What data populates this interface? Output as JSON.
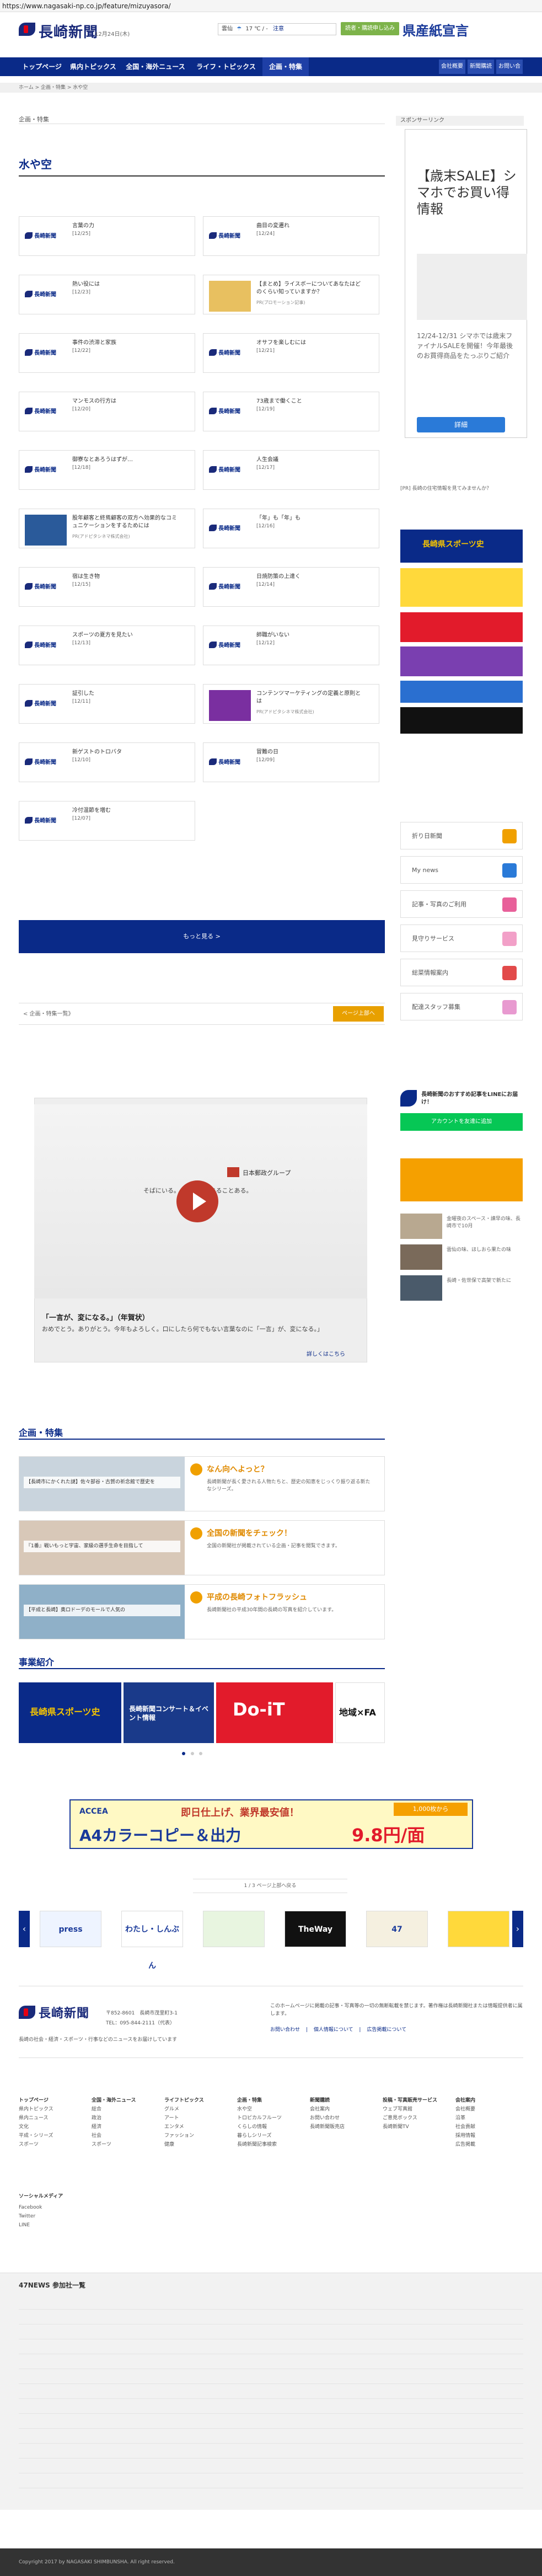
{
  "browser": {
    "url": "https://www.nagasaki-np.co.jp/feature/mizuyasora/"
  },
  "header": {
    "logo": "長崎新聞",
    "date": "12月24日(木)",
    "weather_label": "雲仙",
    "weather_temp": "17 ℃ / -",
    "weather_link": "注意",
    "login_label": "読者・購読申し込み",
    "ken_banner": "県産紙宣言"
  },
  "nav": {
    "items": [
      "トップページ",
      "県内トピックス",
      "全国・海外ニュース",
      "ライフ・トピックス",
      "企画・特集"
    ],
    "sub": [
      "会社概要",
      "新聞購読",
      "お問い合わせ"
    ]
  },
  "breadcrumb": "ホーム > 企画・特集 > 水や空",
  "section_label": "企画・特集",
  "page_title": "水や空",
  "articles": [
    {
      "title": "言葉の力",
      "date": "[12/25]",
      "sub": ""
    },
    {
      "title": "曲目の変遷れ",
      "date": "[12/24]",
      "sub": ""
    },
    {
      "title": "熱い役には",
      "date": "[12/23]",
      "sub": ""
    },
    {
      "title": "【まとめ】ライスボーについてあなたはどのくらい知っていますか？",
      "date": "",
      "sub": "PR(プロモーション記事)"
    },
    {
      "title": "事件の渋滞と家族",
      "date": "[12/22]",
      "sub": ""
    },
    {
      "title": "オサフを楽しむには",
      "date": "[12/21]",
      "sub": ""
    },
    {
      "title": "マンモスの行方は",
      "date": "[12/20]",
      "sub": ""
    },
    {
      "title": "73歳まで働くこと",
      "date": "[12/19]",
      "sub": ""
    },
    {
      "title": "御寮なとあろうはずが…",
      "date": "[12/18]",
      "sub": ""
    },
    {
      "title": "人生会議",
      "date": "[12/17]",
      "sub": ""
    },
    {
      "title": "股年顧客と終焉顧客の双方へ効果的なコミュニケーションをするためには",
      "date": "",
      "sub": "PR(アドピタシネマ株式会社)"
    },
    {
      "title": "「年」も「年」も",
      "date": "[12/16]",
      "sub": ""
    },
    {
      "title": "宿は生き物",
      "date": "[12/15]",
      "sub": ""
    },
    {
      "title": "日焼防策の上達く",
      "date": "[12/14]",
      "sub": ""
    },
    {
      "title": "スポーツの夏方を見たい",
      "date": "[12/13]",
      "sub": ""
    },
    {
      "title": "師職がいない",
      "date": "[12/12]",
      "sub": ""
    },
    {
      "title": "証引した",
      "date": "[12/11]",
      "sub": ""
    },
    {
      "title": "コンテンツマーケティングの定義と原則とは",
      "date": "",
      "sub": "PR(アドピタシネマ株式会社)"
    },
    {
      "title": "新ゲストのトロバタ",
      "date": "[12/10]",
      "sub": ""
    },
    {
      "title": "冒難の日",
      "date": "[12/09]",
      "sub": ""
    },
    {
      "title": "冷付温節を増む",
      "date": "[12/07]",
      "sub": ""
    }
  ],
  "more_label": "もっと見る >",
  "pager": {
    "prev": "< 企画・特集一覧》",
    "next": "ページ上部へ"
  },
  "video_ad": {
    "brand": "日本郵政グループ",
    "tagline": "そばにいる。それが、できることある。",
    "headline": "「一言が、変になる。」（年賀状）",
    "body": "おめでとう。ありがとう。今年もよろしく。口にしたら何でもない言葉なのに「一言」が、変になる。」",
    "link": "詳しくはこちら"
  },
  "features_title": "企画・特集",
  "features": [
    {
      "left": "【長崎市にかくれた謎】佐々部谷・古賀の祈念館で歴史を",
      "right_title": "なん向へよっと？",
      "right_desc": "長崎新聞が長く愛される人物たちと、歴史の知恵をじっくり振り返る新たなシリーズ。"
    },
    {
      "left": "『1番』戦いもっと宇宙、家級の選手生命を目指して",
      "right_title": "全国の新聞をチェック！",
      "right_desc": "全国の新聞社が掲載されている企画・記事を閲覧できます。"
    },
    {
      "left": "【平成と長崎】奥ロドーデのモールで人気の",
      "right_title": "平成の長崎フォトフラッシュ",
      "right_desc": "長崎新聞社の平成30年間の長崎の写真を紹介しています。"
    }
  ],
  "projects_title": "事業紹介",
  "projects": [
    "長崎県スポーツ史",
    "長崎新聞コンサート＆イベント情報",
    "Do-iT",
    "地域×FA"
  ],
  "ad_banner": {
    "brand": "ACCEA",
    "line1": "即日仕上げ、業界最安値！",
    "line2": "A4カラーコピー＆出力",
    "price": "9.8円/面",
    "badge": "1,000枚から"
  },
  "carousel_caption": "1 / 3 ページ上部へ戻る",
  "carousel": [
    "press",
    "わたし・しんぶん",
    "",
    "TheWay",
    "47",
    ""
  ],
  "footer": {
    "address": "〒852-8601　長崎市茂里町3-1",
    "tel": "TEL：095-844-2111（代表）",
    "note": "長崎の社会・経済・スポーツ・行事などのニュースをお届けしています",
    "disclaimer": "このホームページに掲載の記事・写真等の一切の無断転載を禁じます。著作権は長崎新聞社または情報提供者に属します。",
    "links": [
      "お問い合わせ",
      "個人情報について",
      "広告掲載について"
    ],
    "columns": [
      {
        "head": "トップページ",
        "items": [
          "県内トピックス",
          "県内ニュース",
          "文化",
          "平成・シリーズ",
          "スポーツ"
        ]
      },
      {
        "head": "全国・海外ニュース",
        "items": [
          "総合",
          "政治",
          "経済",
          "社会",
          "スポーツ"
        ]
      },
      {
        "head": "ライフトピックス",
        "items": [
          "グルメ",
          "アート",
          "エンタメ",
          "ファッション",
          "健康"
        ]
      },
      {
        "head": "企画・特集",
        "items": [
          "水や空",
          "トロピカルフルーツ",
          "くらしの情報",
          "暮らしシリーズ",
          "長崎新聞記事検索"
        ]
      },
      {
        "head": "新聞購読",
        "items": [
          "会社案内",
          "お問い合わせ",
          "長崎新聞販売店"
        ]
      },
      {
        "head": "投稿・写真販売サービス",
        "items": [
          "ウェブ写真館",
          "ご意見ボックス",
          "長崎新聞TV"
        ]
      },
      {
        "head": "会社案内",
        "items": [
          "会社概要",
          "沿革",
          "社会貢献",
          "採用情報",
          "広告掲載"
        ]
      }
    ],
    "social_head": "ソーシャルメディア",
    "social": [
      "Facebook",
      "Twitter",
      "LINE"
    ]
  },
  "news47": {
    "title": "47NEWS 参加社一覧",
    "copyright": "Copyright 2017 by NAGASAKI SHIMBUNSHA. All right reserved."
  },
  "sidebar": {
    "sponsor_label": "スポンサーリンク",
    "sale_text": "【歳末SALE】シマホでお買い得情報",
    "sale_desc": "12/24-12/31 シマホでは歳末ファイナルSALEを開催！今年最後のお買得商品をたっぷりご紹介",
    "sale_btn": "詳細",
    "pr_text": "[PR] 長崎の住宅情報を見てみませんか？",
    "items": [
      "折り日新聞",
      "My news",
      "記事・写真のご利用",
      "見守りサービス",
      "総菜情報案内",
      "配達スタッフ募集"
    ],
    "line_head": "長崎新聞のおすすめ記事をLINEにお届け！",
    "line_btn": "アカウントを友達に追加",
    "news_items": [
      "金曜夜のスペース・諫早の味、長崎市で10月",
      "雲仙の味、ほしおら果たの味",
      "長崎・佐世保で高架で新たに"
    ]
  }
}
